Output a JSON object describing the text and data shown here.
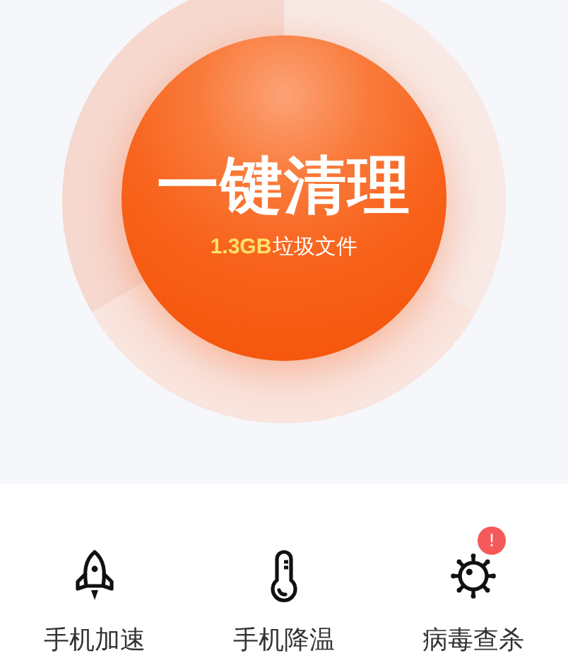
{
  "cleaner": {
    "title": "一键清理",
    "size": "1.3GB",
    "label": "垃圾文件"
  },
  "tools": [
    {
      "kind": "rocket",
      "label": "手机加速"
    },
    {
      "kind": "thermometer",
      "label": "手机降温"
    },
    {
      "kind": "virus",
      "label": "病毒查杀",
      "badge": "!"
    }
  ]
}
